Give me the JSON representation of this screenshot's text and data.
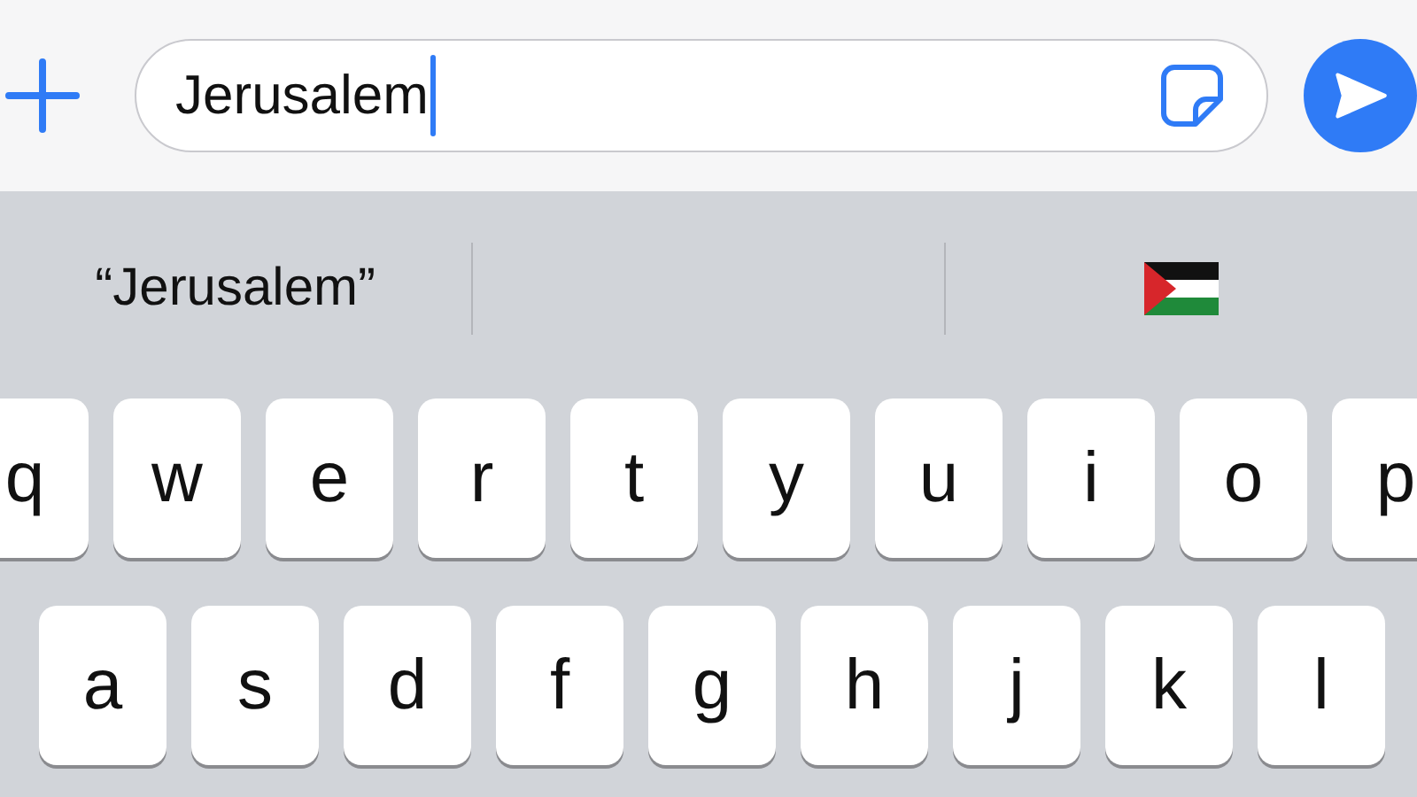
{
  "message_field": {
    "value": "Jerusalem"
  },
  "suggestions": [
    {
      "kind": "text",
      "text": "“Jerusalem”"
    },
    {
      "kind": "empty"
    },
    {
      "kind": "flag"
    }
  ],
  "keyboard": {
    "rows": [
      [
        "q",
        "w",
        "e",
        "r",
        "t",
        "y",
        "u",
        "i",
        "o",
        "p"
      ],
      [
        "a",
        "s",
        "d",
        "f",
        "g",
        "h",
        "j",
        "k",
        "l"
      ]
    ]
  }
}
